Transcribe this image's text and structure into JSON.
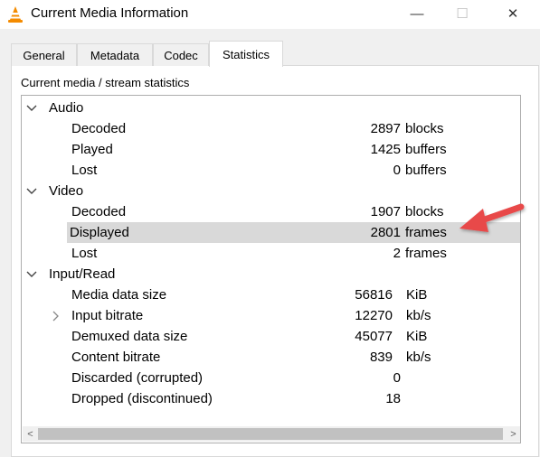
{
  "window": {
    "title": "Current Media Information",
    "icon": "vlc-cone-icon",
    "minimize_glyph": "—",
    "maximize_glyph": "☐",
    "close_glyph": "✕"
  },
  "tabs": [
    {
      "label": "General"
    },
    {
      "label": "Metadata"
    },
    {
      "label": "Codec"
    },
    {
      "label": "Statistics",
      "active": true
    }
  ],
  "panel": {
    "caption": "Current media / stream statistics"
  },
  "groups": {
    "audio": {
      "label": "Audio",
      "expanded": true,
      "items": [
        {
          "label": "Decoded",
          "value": "2897",
          "unit": "blocks"
        },
        {
          "label": "Played",
          "value": "1425",
          "unit": "buffers"
        },
        {
          "label": "Lost",
          "value": "0",
          "unit": "buffers"
        }
      ]
    },
    "video": {
      "label": "Video",
      "expanded": true,
      "items": [
        {
          "label": "Decoded",
          "value": "1907",
          "unit": "blocks"
        },
        {
          "label": "Displayed",
          "value": "2801",
          "unit": "frames",
          "selected": true
        },
        {
          "label": "Lost",
          "value": "2",
          "unit": "frames"
        }
      ]
    },
    "input": {
      "label": "Input/Read",
      "expanded": true,
      "items": [
        {
          "label": "Media data size",
          "value": "56816",
          "unit": "KiB"
        },
        {
          "label": "Input bitrate",
          "value": "12270",
          "unit": "kb/s",
          "collapsed_child": true
        },
        {
          "label": "Demuxed data size",
          "value": "45077",
          "unit": "KiB"
        },
        {
          "label": "Content bitrate",
          "value": "839",
          "unit": "kb/s"
        },
        {
          "label": "Discarded (corrupted)",
          "value": "0",
          "unit": ""
        },
        {
          "label": "Dropped (discontinued)",
          "value": "18",
          "unit": ""
        }
      ]
    }
  },
  "scrollbar": {
    "left_glyph": "<",
    "right_glyph": ">"
  },
  "colors": {
    "selection": "#d9d9d9",
    "annotation_arrow": "#e8484a",
    "vlc_orange": "#f48b00"
  }
}
